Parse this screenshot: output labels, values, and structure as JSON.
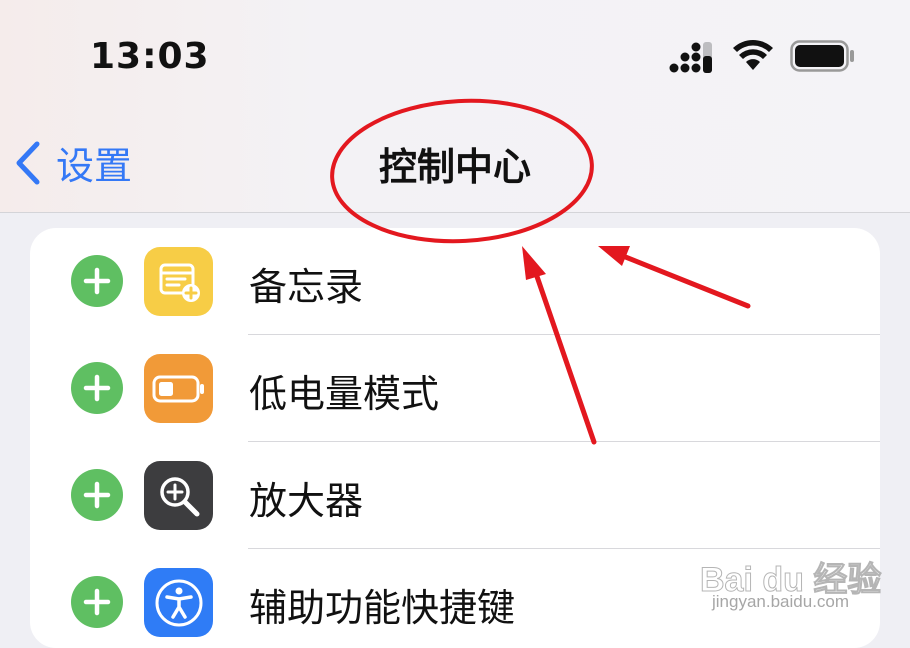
{
  "status_bar": {
    "time": "13:03"
  },
  "nav": {
    "back_label": "设置",
    "title": "控制中心"
  },
  "controls": [
    {
      "label": "备忘录",
      "icon": "notes-icon",
      "color": "#f7cd46"
    },
    {
      "label": "低电量模式",
      "icon": "low-power-mode-icon",
      "color": "#f19a38"
    },
    {
      "label": "放大器",
      "icon": "magnifier-icon",
      "color": "#3d3d3f"
    },
    {
      "label": "辅助功能快捷键",
      "icon": "accessibility-icon",
      "color": "#2f7cf6"
    }
  ],
  "colors": {
    "accent": "#3478f6",
    "add_green": "#5fbf62",
    "annotation_red": "#e3181f"
  },
  "watermark": {
    "logo": "Bai du 经验",
    "url": "jingyan.baidu.com"
  }
}
